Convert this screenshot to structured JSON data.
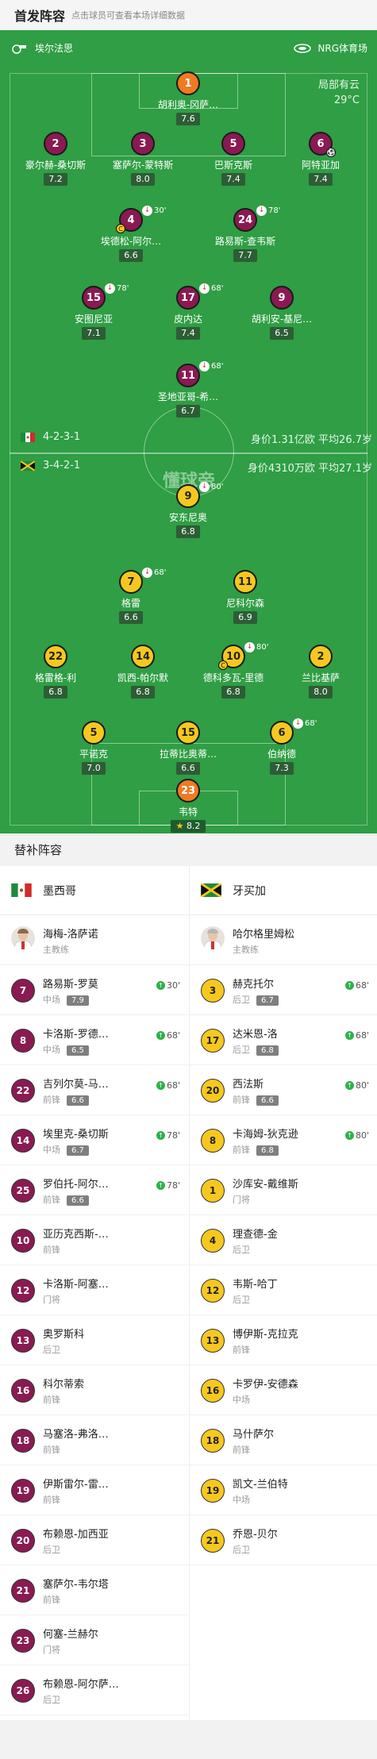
{
  "header": {
    "title": "首发阵容",
    "subtitle": "点击球员可查看本场详细数据"
  },
  "pitch": {
    "home_coach_name": "埃尔法思",
    "venue": "NRG体育场",
    "weather": "局部有云",
    "temperature": "29°C",
    "logo": "懂球帝",
    "home_formation": "4-2-3-1",
    "away_formation": "3-4-2-1",
    "home_value": "身价1.31亿欧  平均26.7岁",
    "away_value": "身价4310万欧  平均27.1岁"
  },
  "home_lineup": [
    {
      "num": "1",
      "name": "胡利奥-冈萨…",
      "rating": "7.6",
      "role": "gk"
    },
    {
      "num": "2",
      "name": "豪尔赫-桑切斯",
      "rating": "7.2"
    },
    {
      "num": "3",
      "name": "塞萨尔-蒙特斯",
      "rating": "8.0"
    },
    {
      "num": "5",
      "name": "巴斯克斯",
      "rating": "7.4"
    },
    {
      "num": "6",
      "name": "阿特亚加",
      "rating": "7.4",
      "goal": true
    },
    {
      "num": "4",
      "name": "埃德松-阿尔…",
      "rating": "6.6",
      "sub": "30'",
      "captain": true
    },
    {
      "num": "24",
      "name": "路易斯-查韦斯",
      "rating": "7.7",
      "sub": "78'"
    },
    {
      "num": "15",
      "name": "安图尼亚",
      "rating": "7.1",
      "sub": "78'"
    },
    {
      "num": "17",
      "name": "皮内达",
      "rating": "7.4",
      "sub": "68'"
    },
    {
      "num": "9",
      "name": "胡利安-基尼…",
      "rating": "6.5"
    },
    {
      "num": "11",
      "name": "圣地亚哥-希…",
      "rating": "6.7",
      "sub": "68'"
    }
  ],
  "away_lineup": [
    {
      "num": "9",
      "name": "安东尼奥",
      "rating": "6.8",
      "sub": "80'"
    },
    {
      "num": "7",
      "name": "格雷",
      "rating": "6.6",
      "sub": "68'"
    },
    {
      "num": "11",
      "name": "尼科尔森",
      "rating": "6.9"
    },
    {
      "num": "22",
      "name": "格雷格-利",
      "rating": "6.8"
    },
    {
      "num": "14",
      "name": "凯西-帕尔默",
      "rating": "6.8"
    },
    {
      "num": "10",
      "name": "德科多瓦-里德",
      "rating": "6.8",
      "sub": "80'",
      "captain": true
    },
    {
      "num": "2",
      "name": "兰比基萨",
      "rating": "8.0"
    },
    {
      "num": "5",
      "name": "平诺克",
      "rating": "7.0"
    },
    {
      "num": "15",
      "name": "拉蒂比奥蒂…",
      "rating": "6.6"
    },
    {
      "num": "6",
      "name": "伯纳德",
      "rating": "7.3",
      "sub": "68'"
    },
    {
      "num": "23",
      "name": "韦特",
      "rating": "8.2",
      "role": "gk",
      "star": "★"
    }
  ],
  "bench_section": {
    "title": "替补阵容"
  },
  "home_bench": {
    "team": "墨西哥",
    "coach": {
      "name": "海梅-洛萨诺",
      "role": "主教练"
    },
    "players": [
      {
        "num": "7",
        "name": "路易斯-罗莫",
        "pos": "中场",
        "rating": "7.9",
        "time": "30'"
      },
      {
        "num": "8",
        "name": "卡洛斯-罗德…",
        "pos": "中场",
        "rating": "6.5",
        "time": "68'"
      },
      {
        "num": "22",
        "name": "吉列尔莫-马…",
        "pos": "前锋",
        "rating": "6.6",
        "time": "68'"
      },
      {
        "num": "14",
        "name": "埃里克-桑切斯",
        "pos": "中场",
        "rating": "6.7",
        "time": "78'"
      },
      {
        "num": "25",
        "name": "罗伯托-阿尔…",
        "pos": "前锋",
        "rating": "6.6",
        "time": "78'"
      },
      {
        "num": "10",
        "name": "亚历克西斯-…",
        "pos": "前锋"
      },
      {
        "num": "12",
        "name": "卡洛斯-阿塞…",
        "pos": "门将"
      },
      {
        "num": "13",
        "name": "奥罗斯科",
        "pos": "后卫"
      },
      {
        "num": "16",
        "name": "科尔蒂索",
        "pos": "前锋"
      },
      {
        "num": "18",
        "name": "马塞洛-弗洛…",
        "pos": "前锋"
      },
      {
        "num": "19",
        "name": "伊斯雷尔-雷…",
        "pos": "前锋"
      },
      {
        "num": "20",
        "name": "布赖恩-加西亚",
        "pos": "后卫"
      },
      {
        "num": "21",
        "name": "塞萨尔-韦尔塔",
        "pos": "前锋"
      },
      {
        "num": "23",
        "name": "何塞-兰赫尔",
        "pos": "门将"
      },
      {
        "num": "26",
        "name": "布赖恩-阿尔萨…",
        "pos": "后卫"
      }
    ]
  },
  "away_bench": {
    "team": "牙买加",
    "coach": {
      "name": "哈尔格里姆松",
      "role": "主教练"
    },
    "players": [
      {
        "num": "3",
        "name": "赫克托尔",
        "pos": "后卫",
        "rating": "6.7",
        "time": "68'"
      },
      {
        "num": "17",
        "name": "达米恩-洛",
        "pos": "后卫",
        "rating": "6.8",
        "time": "68'"
      },
      {
        "num": "20",
        "name": "西法斯",
        "pos": "前锋",
        "rating": "6.6",
        "time": "80'"
      },
      {
        "num": "8",
        "name": "卡海姆-狄克逊",
        "pos": "前锋",
        "rating": "6.8",
        "time": "80'"
      },
      {
        "num": "1",
        "name": "沙库安-戴维斯",
        "pos": "门将"
      },
      {
        "num": "4",
        "name": "理查德-金",
        "pos": "后卫"
      },
      {
        "num": "12",
        "name": "韦斯-哈丁",
        "pos": "后卫"
      },
      {
        "num": "13",
        "name": "博伊斯-克拉克",
        "pos": "前锋"
      },
      {
        "num": "16",
        "name": "卡罗伊-安德森",
        "pos": "中场"
      },
      {
        "num": "18",
        "name": "马什萨尔",
        "pos": "前锋"
      },
      {
        "num": "19",
        "name": "凯文-兰伯特",
        "pos": "中场"
      },
      {
        "num": "21",
        "name": "乔恩-贝尔",
        "pos": "后卫"
      }
    ]
  },
  "colors": {
    "home": "#8a1a52",
    "away": "#f6c81f",
    "pitch": "#2f9e44"
  }
}
